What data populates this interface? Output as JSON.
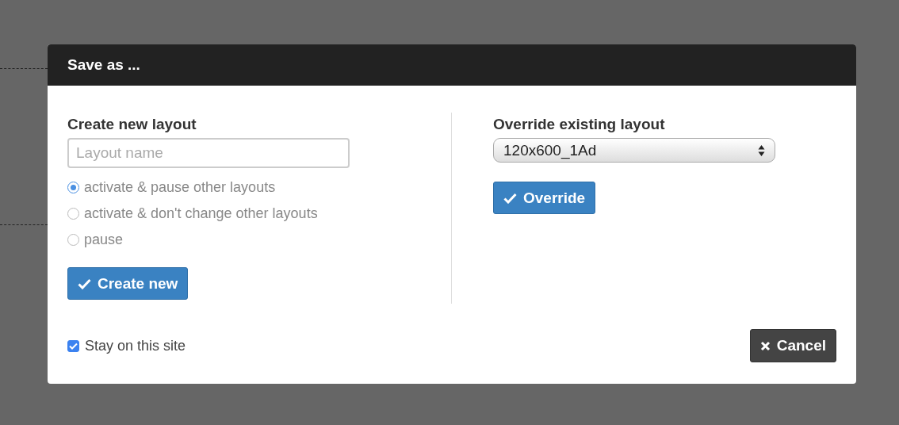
{
  "dialog": {
    "title": "Save as ..."
  },
  "create": {
    "heading": "Create new layout",
    "name_field": {
      "placeholder": "Layout name"
    },
    "options": [
      {
        "label": "activate & pause other layouts",
        "selected": true
      },
      {
        "label": "activate & don't change other layouts",
        "selected": false
      },
      {
        "label": "pause",
        "selected": false
      }
    ],
    "button": "Create new"
  },
  "override": {
    "heading": "Override existing layout",
    "layout_select": {
      "value": "120x600_1Ad"
    },
    "button": "Override"
  },
  "stay_on_site": {
    "label": "Stay on this site",
    "checked": true
  },
  "cancel_button": "Cancel"
}
